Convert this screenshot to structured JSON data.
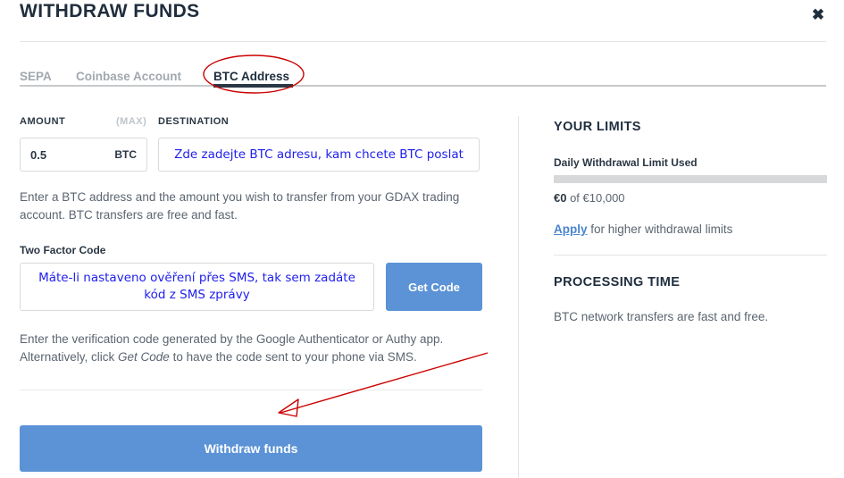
{
  "header": {
    "title": "WITHDRAW FUNDS",
    "close_icon": "close-x-icon"
  },
  "tabs": [
    {
      "label": "SEPA",
      "active": false
    },
    {
      "label": "Coinbase Account",
      "active": false
    },
    {
      "label": "BTC Address",
      "active": true
    }
  ],
  "form": {
    "amount_label": "AMOUNT",
    "max_label": "(MAX)",
    "destination_label": "DESTINATION",
    "amount_value": "0.5",
    "amount_unit": "BTC",
    "destination_annotation": "Zde zadejte BTC adresu, kam chcete BTC poslat",
    "help_text": "Enter a BTC address and the amount you wish to transfer from your GDAX trading account. BTC transfers are free and fast.",
    "two_factor_label": "Two Factor Code",
    "two_factor_annotation_line1": "Máte-li nastaveno ověření přes SMS, tak sem zadáte kód",
    "two_factor_annotation_line2": "z SMS zprávy",
    "get_code_label": "Get Code",
    "verify_text_a": "Enter the verification code generated by the Google Authenticator or Authy app. Alternatively, click ",
    "verify_text_em": "Get Code",
    "verify_text_b": " to have the code sent to your phone via SMS.",
    "submit_label": "Withdraw funds"
  },
  "limits": {
    "section_title": "YOUR LIMITS",
    "daily_label": "Daily Withdrawal Limit Used",
    "used_amount": "€0",
    "of_text": " of ",
    "total_amount": "€10,000",
    "progress_percent": 0,
    "apply_link": "Apply",
    "apply_rest": " for higher withdrawal limits"
  },
  "processing": {
    "section_title": "PROCESSING TIME",
    "text": "BTC network transfers are fast and free."
  },
  "colors": {
    "accent_blue": "#5b93d6",
    "title_navy": "#1f2d3d",
    "annotation_red": "#cc0000",
    "annotation_blue": "#2020ee",
    "link_blue": "#4a85cf"
  }
}
